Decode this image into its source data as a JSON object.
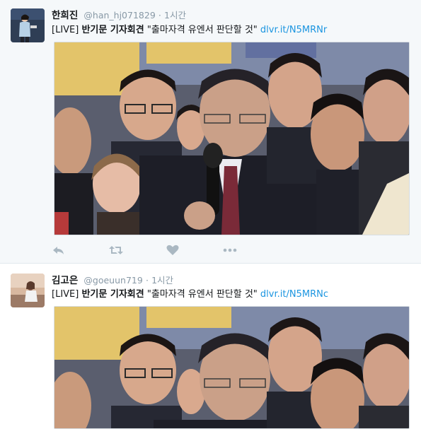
{
  "tweets": [
    {
      "name": "한희진",
      "handle": "@han_hj071829",
      "separator": "·",
      "time": "1시간",
      "text_prefix": "[LIVE]",
      "text_bold": "반기문 기자회견",
      "text_quote": "\"출마자격 유엔서 판단할 것\"",
      "link": "dlvr.it/N5MRNr"
    },
    {
      "name": "김고은",
      "handle": "@goeuun719",
      "separator": "·",
      "time": "1시간",
      "text_prefix": "[LIVE]",
      "text_bold": "반기문 기자회견",
      "text_quote": "\"출마자격 유엔서 판단할 것\"",
      "link": "dlvr.it/N5MRNc"
    }
  ],
  "icons": [
    "reply-icon",
    "retweet-icon",
    "like-icon",
    "more-icon"
  ],
  "colors": {
    "link": "#1b95e0",
    "muted": "#8899a6",
    "action": "#aab8c2",
    "highlight_bg": "#f5f8fa"
  }
}
